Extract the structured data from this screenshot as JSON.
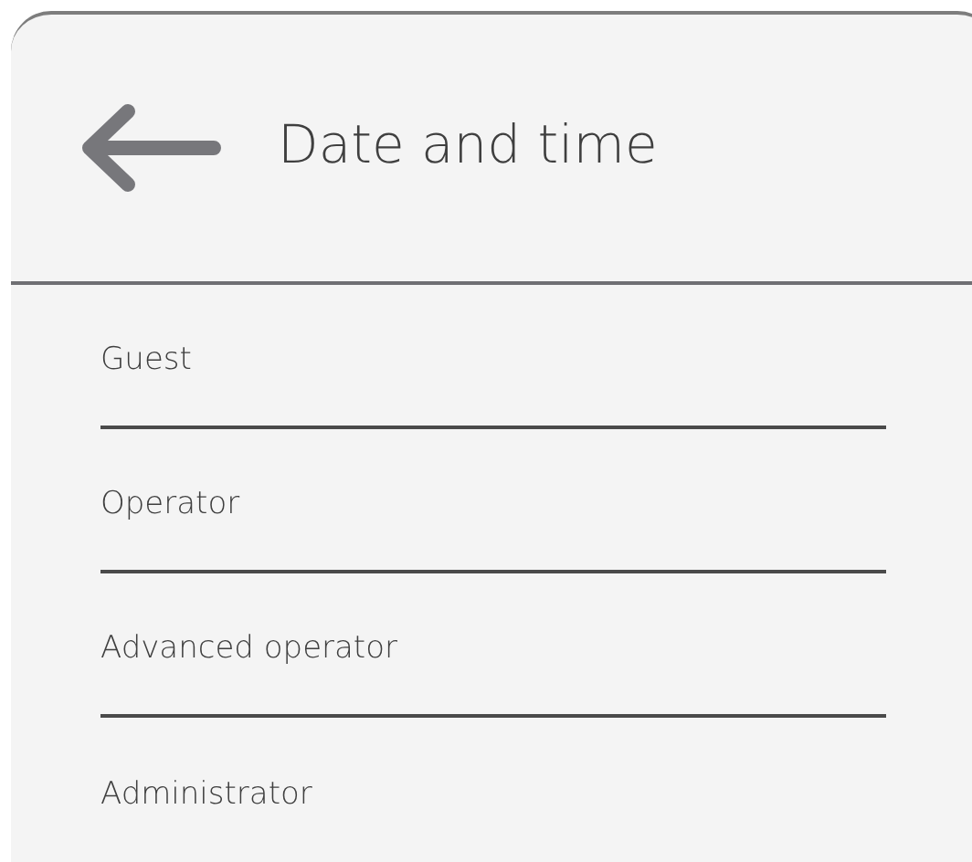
{
  "header": {
    "title": "Date and time"
  },
  "items": [
    {
      "label": "Guest"
    },
    {
      "label": "Operator"
    },
    {
      "label": "Advanced operator"
    },
    {
      "label": "Administrator"
    }
  ]
}
